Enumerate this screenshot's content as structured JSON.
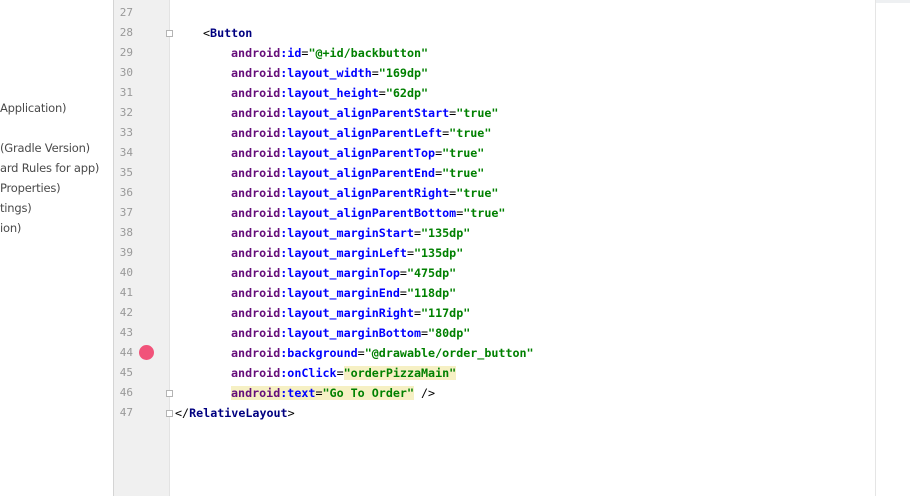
{
  "project_tree": {
    "items": [
      "Application)",
      "(Gradle Version)",
      "ard Rules for app)",
      "Properties)",
      "tings)",
      "ion)"
    ]
  },
  "editor": {
    "line_numbers": [
      "27",
      "28",
      "29",
      "30",
      "31",
      "32",
      "33",
      "34",
      "35",
      "36",
      "37",
      "38",
      "39",
      "40",
      "41",
      "42",
      "43",
      "44",
      "45",
      "46",
      "47"
    ],
    "lines": [
      {
        "line": "27",
        "parts": []
      },
      {
        "line": "28",
        "parts": [
          [
            "plain",
            "<"
          ],
          [
            "tag",
            "Button"
          ]
        ],
        "indent": 1
      },
      {
        "line": "29",
        "parts": [
          [
            "ns",
            "android"
          ],
          [
            "attr",
            ":id"
          ],
          [
            "plain",
            "="
          ],
          [
            "val",
            "\"@+id/backbutton\""
          ]
        ],
        "indent": 2
      },
      {
        "line": "30",
        "parts": [
          [
            "ns",
            "android"
          ],
          [
            "attr",
            ":layout_width"
          ],
          [
            "plain",
            "="
          ],
          [
            "val",
            "\"169dp\""
          ]
        ],
        "indent": 2
      },
      {
        "line": "31",
        "parts": [
          [
            "ns",
            "android"
          ],
          [
            "attr",
            ":layout_height"
          ],
          [
            "plain",
            "="
          ],
          [
            "val",
            "\"62dp\""
          ]
        ],
        "indent": 2
      },
      {
        "line": "32",
        "parts": [
          [
            "ns",
            "android"
          ],
          [
            "attr",
            ":layout_alignParentStart"
          ],
          [
            "plain",
            "="
          ],
          [
            "val",
            "\"true\""
          ]
        ],
        "indent": 2
      },
      {
        "line": "33",
        "parts": [
          [
            "ns",
            "android"
          ],
          [
            "attr",
            ":layout_alignParentLeft"
          ],
          [
            "plain",
            "="
          ],
          [
            "val",
            "\"true\""
          ]
        ],
        "indent": 2
      },
      {
        "line": "34",
        "parts": [
          [
            "ns",
            "android"
          ],
          [
            "attr",
            ":layout_alignParentTop"
          ],
          [
            "plain",
            "="
          ],
          [
            "val",
            "\"true\""
          ]
        ],
        "indent": 2
      },
      {
        "line": "35",
        "parts": [
          [
            "ns",
            "android"
          ],
          [
            "attr",
            ":layout_alignParentEnd"
          ],
          [
            "plain",
            "="
          ],
          [
            "val",
            "\"true\""
          ]
        ],
        "indent": 2
      },
      {
        "line": "36",
        "parts": [
          [
            "ns",
            "android"
          ],
          [
            "attr",
            ":layout_alignParentRight"
          ],
          [
            "plain",
            "="
          ],
          [
            "val",
            "\"true\""
          ]
        ],
        "indent": 2
      },
      {
        "line": "37",
        "parts": [
          [
            "ns",
            "android"
          ],
          [
            "attr",
            ":layout_alignParentBottom"
          ],
          [
            "plain",
            "="
          ],
          [
            "val",
            "\"true\""
          ]
        ],
        "indent": 2
      },
      {
        "line": "38",
        "parts": [
          [
            "ns",
            "android"
          ],
          [
            "attr",
            ":layout_marginStart"
          ],
          [
            "plain",
            "="
          ],
          [
            "val",
            "\"135dp\""
          ]
        ],
        "indent": 2
      },
      {
        "line": "39",
        "parts": [
          [
            "ns",
            "android"
          ],
          [
            "attr",
            ":layout_marginLeft"
          ],
          [
            "plain",
            "="
          ],
          [
            "val",
            "\"135dp\""
          ]
        ],
        "indent": 2
      },
      {
        "line": "40",
        "parts": [
          [
            "ns",
            "android"
          ],
          [
            "attr",
            ":layout_marginTop"
          ],
          [
            "plain",
            "="
          ],
          [
            "val",
            "\"475dp\""
          ]
        ],
        "indent": 2
      },
      {
        "line": "41",
        "parts": [
          [
            "ns",
            "android"
          ],
          [
            "attr",
            ":layout_marginEnd"
          ],
          [
            "plain",
            "="
          ],
          [
            "val",
            "\"118dp\""
          ]
        ],
        "indent": 2
      },
      {
        "line": "42",
        "parts": [
          [
            "ns",
            "android"
          ],
          [
            "attr",
            ":layout_marginRight"
          ],
          [
            "plain",
            "="
          ],
          [
            "val",
            "\"117dp\""
          ]
        ],
        "indent": 2
      },
      {
        "line": "43",
        "parts": [
          [
            "ns",
            "android"
          ],
          [
            "attr",
            ":layout_marginBottom"
          ],
          [
            "plain",
            "="
          ],
          [
            "val",
            "\"80dp\""
          ]
        ],
        "indent": 2
      },
      {
        "line": "44",
        "parts": [
          [
            "ns",
            "android"
          ],
          [
            "attr",
            ":background"
          ],
          [
            "plain",
            "="
          ],
          [
            "val",
            "\"@drawable/order_button\""
          ]
        ],
        "indent": 2
      },
      {
        "line": "45",
        "parts": [
          [
            "ns",
            "android"
          ],
          [
            "attr",
            ":onClick"
          ],
          [
            "plain",
            "="
          ],
          [
            "val",
            "\"orderPizzaMain\""
          ]
        ],
        "indent": 2
      },
      {
        "line": "46",
        "parts": [
          [
            "ns",
            "android"
          ],
          [
            "attr",
            ":text"
          ],
          [
            "plain",
            "="
          ],
          [
            "val",
            "\"Go To Order\""
          ],
          [
            "plain",
            " />"
          ]
        ],
        "indent": 2
      },
      {
        "line": "47",
        "parts": [
          [
            "plain",
            "</"
          ],
          [
            "tag",
            "RelativeLayout"
          ],
          [
            "plain",
            ">"
          ]
        ],
        "indent": 0
      }
    ],
    "breakpoint_line": "44",
    "highlight_line": "46",
    "highlight_text_line": "45",
    "squiggle_value": "backbutton",
    "icons": {
      "fold_open": "fold-open-icon",
      "fold_close": "fold-close-icon",
      "breakpoint": "breakpoint-icon"
    },
    "colors": {
      "breakpoint": "#f1537a",
      "highlight": "#f6f0c4",
      "tag": "#000080",
      "namespace": "#660e7a",
      "attribute": "#0000ff",
      "value": "#008000"
    }
  }
}
